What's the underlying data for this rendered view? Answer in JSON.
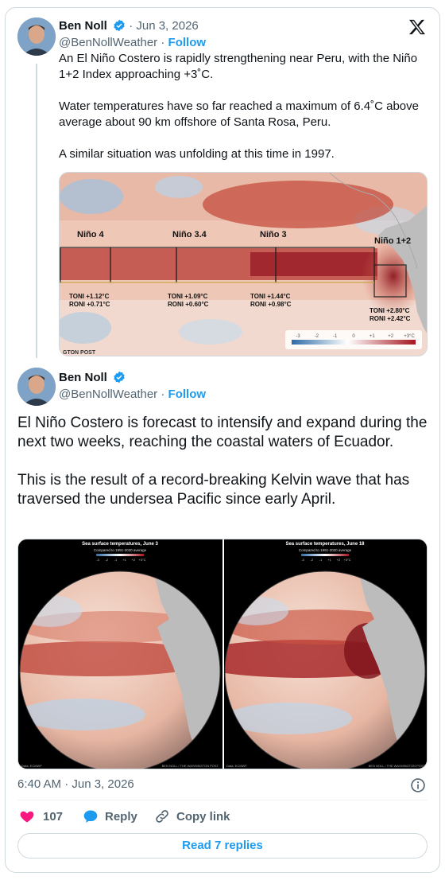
{
  "tweet1": {
    "author_name": "Ben Noll",
    "handle": "@BenNollWeather",
    "date": "Jun 3, 2026",
    "follow_label": "Follow",
    "paragraphs": [
      "An El Niño Costero is rapidly strengthening near Peru, with the Niño 1+2 Index approaching +3˚C.",
      "Water temperatures have so far reached a maximum of 6.4˚C above average about 90 km offshore of Santa Rosa, Peru.",
      "A similar situation was unfolding at this time in 1997."
    ],
    "map": {
      "regions": [
        {
          "name": "Niño 4",
          "toni": "TONI +1.12°C",
          "roni": "RONI +0.71°C"
        },
        {
          "name": "Niño 3.4",
          "toni": "TONI +1.09°C",
          "roni": "RONI +0.60°C"
        },
        {
          "name": "Niño 3",
          "toni": "TONI +1.44°C",
          "roni": "RONI +0.98°C"
        },
        {
          "name": "Niño 1+2",
          "toni": "TONI +2.80°C",
          "roni": "RONI +2.42°C"
        }
      ],
      "scale_ticks": [
        "-3",
        "-2",
        "-1",
        "0",
        "+1",
        "+2",
        "+3°C"
      ],
      "credit": "GTON POST"
    }
  },
  "tweet2": {
    "author_name": "Ben Noll",
    "handle": "@BenNollWeather",
    "follow_label": "Follow",
    "paragraphs": [
      "El Niño Costero is forecast to intensify and expand during the next two weeks, reaching the coastal waters of Ecuador.",
      "This is the result of a record-breaking Kelvin wave that has traversed the undersea Pacific since early April."
    ],
    "globes": [
      {
        "title": "Sea surface temperatures, June 3",
        "subtitle": "Compared to 1991-2020 average",
        "data_credit": "Data: ECMWF",
        "author_credit": "BEN NOLL / THE WASHINGTON POST"
      },
      {
        "title": "Sea surface temperatures, June 18",
        "subtitle": "Compared to 1991-2020 average",
        "data_credit": "Data: ECMWF",
        "author_credit": "BEN NOLL / THE WASHINGTON POST"
      }
    ],
    "scale_ticks": [
      "-3",
      "-2",
      "-1",
      "+1",
      "+2",
      "+3°C"
    ],
    "timestamp": "6:40 AM · Jun 3, 2026",
    "likes": "107",
    "reply_label": "Reply",
    "copy_link_label": "Copy link",
    "read_replies_label": "Read 7 replies"
  },
  "colors": {
    "accent": "#1d9bf0",
    "like": "#f91880",
    "text": "#0f1419",
    "muted": "#536471",
    "border": "#cfd9de"
  },
  "icons": {
    "verified": "verified-badge-icon",
    "logo": "x-logo-icon",
    "info": "info-icon",
    "like": "heart-icon",
    "reply": "speech-bubble-icon",
    "copy_link": "link-icon"
  }
}
